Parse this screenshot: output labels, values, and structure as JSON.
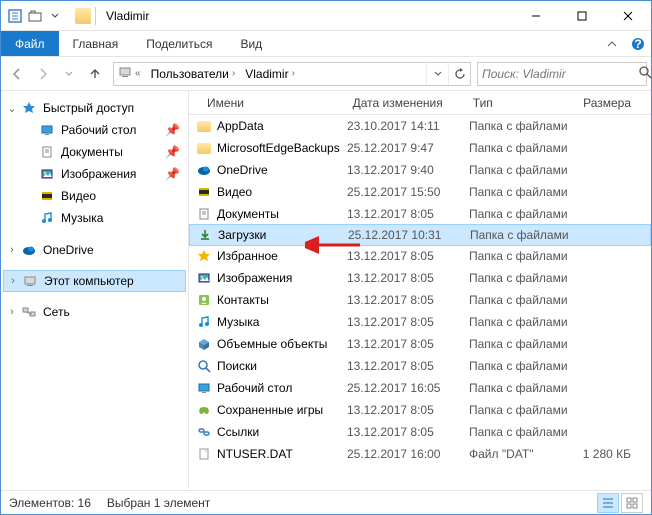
{
  "window": {
    "title": "Vladimir"
  },
  "ribbon": {
    "file": "Файл",
    "tabs": [
      "Главная",
      "Поделиться",
      "Вид"
    ]
  },
  "address": {
    "segments": [
      "Пользователи",
      "Vladimir"
    ]
  },
  "search": {
    "placeholder": "Поиск: Vladimir"
  },
  "nav": {
    "quick": "Быстрый доступ",
    "quick_items": [
      {
        "label": "Рабочий стол",
        "pin": true,
        "icon": "desktop"
      },
      {
        "label": "Документы",
        "pin": true,
        "icon": "documents"
      },
      {
        "label": "Изображения",
        "pin": true,
        "icon": "pictures"
      },
      {
        "label": "Видео",
        "pin": false,
        "icon": "video"
      },
      {
        "label": "Музыка",
        "pin": false,
        "icon": "music"
      }
    ],
    "onedrive": "OneDrive",
    "thispc": "Этот компьютер",
    "network": "Сеть"
  },
  "columns": {
    "name": "Имени",
    "date": "Дата изменения",
    "type": "Тип",
    "size": "Размера"
  },
  "type_folder": "Папка с файлами",
  "type_dat": "Файл \"DAT\"",
  "files": [
    {
      "icon": "folder",
      "name": "AppData",
      "date": "23.10.2017 14:11",
      "type": "folder",
      "size": ""
    },
    {
      "icon": "folder",
      "name": "MicrosoftEdgeBackups",
      "date": "25.12.2017 9:47",
      "type": "folder",
      "size": ""
    },
    {
      "icon": "onedrive",
      "name": "OneDrive",
      "date": "13.12.2017 9:40",
      "type": "folder",
      "size": ""
    },
    {
      "icon": "video",
      "name": "Видео",
      "date": "25.12.2017 15:50",
      "type": "folder",
      "size": ""
    },
    {
      "icon": "documents",
      "name": "Документы",
      "date": "13.12.2017 8:05",
      "type": "folder",
      "size": ""
    },
    {
      "icon": "downloads",
      "name": "Загрузки",
      "date": "25.12.2017 10:31",
      "type": "folder",
      "size": "",
      "selected": true
    },
    {
      "icon": "favorites",
      "name": "Избранное",
      "date": "13.12.2017 8:05",
      "type": "folder",
      "size": ""
    },
    {
      "icon": "pictures",
      "name": "Изображения",
      "date": "13.12.2017 8:05",
      "type": "folder",
      "size": ""
    },
    {
      "icon": "contacts",
      "name": "Контакты",
      "date": "13.12.2017 8:05",
      "type": "folder",
      "size": ""
    },
    {
      "icon": "music",
      "name": "Музыка",
      "date": "13.12.2017 8:05",
      "type": "folder",
      "size": ""
    },
    {
      "icon": "3d",
      "name": "Объемные объекты",
      "date": "13.12.2017 8:05",
      "type": "folder",
      "size": ""
    },
    {
      "icon": "search",
      "name": "Поиски",
      "date": "13.12.2017 8:05",
      "type": "folder",
      "size": ""
    },
    {
      "icon": "desktop",
      "name": "Рабочий стол",
      "date": "25.12.2017 16:05",
      "type": "folder",
      "size": ""
    },
    {
      "icon": "games",
      "name": "Сохраненные игры",
      "date": "13.12.2017 8:05",
      "type": "folder",
      "size": ""
    },
    {
      "icon": "links",
      "name": "Ссылки",
      "date": "13.12.2017 8:05",
      "type": "folder",
      "size": ""
    },
    {
      "icon": "file",
      "name": "NTUSER.DAT",
      "date": "25.12.2017 16:00",
      "type": "dat",
      "size": "1 280 КБ"
    }
  ],
  "status": {
    "count_label": "Элементов: 16",
    "selection_label": "Выбран 1 элемент"
  }
}
